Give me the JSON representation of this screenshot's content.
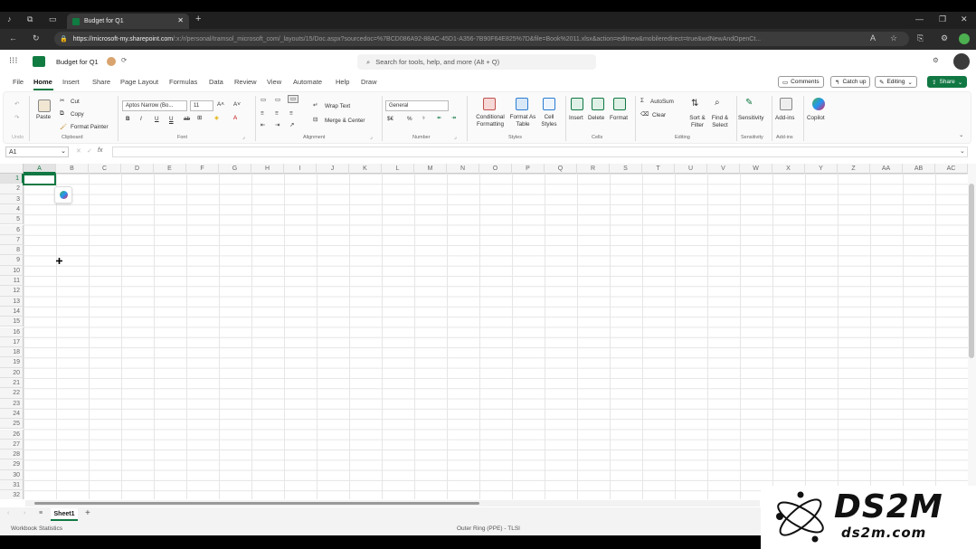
{
  "browser": {
    "tab_title": "Budget for Q1",
    "url_host": "https://microsoft-my.sharepoint.com",
    "url_rest": "/:x:/r/personal/tramsol_microsoft_com/_layouts/15/Doc.aspx?sourcedoc=%7BCD086A92-88AC-45D1-A356-7B90F64E825%7D&file=Book%2011.xlsx&action=editnew&mobileredirect=true&wdNewAndOpenCt..."
  },
  "app": {
    "doc_title": "Budget for Q1",
    "search_placeholder": "Search for tools, help, and more (Alt + Q)"
  },
  "ribbon_tabs": [
    "File",
    "Home",
    "Insert",
    "Share",
    "Page Layout",
    "Formulas",
    "Data",
    "Review",
    "View",
    "Automate",
    "Help",
    "Draw"
  ],
  "header_buttons": {
    "comments": "Comments",
    "catch_up": "Catch up",
    "editing": "Editing",
    "share": "Share"
  },
  "ribbon": {
    "clipboard": {
      "paste": "Paste",
      "cut": "Cut",
      "copy": "Copy",
      "format_painter": "Format Painter",
      "label": "Clipboard",
      "undo_label": "Undo"
    },
    "font": {
      "font_name": "Aptos Narrow (Bo...",
      "font_size": "11",
      "label": "Font"
    },
    "alignment": {
      "wrap_text": "Wrap Text",
      "merge_center": "Merge & Center",
      "label": "Alignment"
    },
    "number": {
      "format": "General",
      "label": "Number"
    },
    "styles": {
      "conditional": "Conditional Formatting",
      "format_as_table": "Format As Table",
      "cell_styles": "Cell Styles",
      "label": "Styles"
    },
    "cells": {
      "insert": "Insert",
      "delete": "Delete",
      "format": "Format",
      "label": "Cells"
    },
    "editing": {
      "autosum": "AutoSum",
      "clear": "Clear",
      "sort_filter": "Sort & Filter",
      "find_select": "Find & Select",
      "label": "Editing"
    },
    "sensitivity": {
      "button": "Sensitivity",
      "label": "Sensitivity"
    },
    "addins": {
      "button": "Add-ins",
      "label": "Add-ins"
    },
    "copilot": {
      "button": "Copilot"
    }
  },
  "formula_bar": {
    "name_box": "A1",
    "fx": "fx"
  },
  "columns": [
    "A",
    "B",
    "C",
    "D",
    "E",
    "F",
    "G",
    "H",
    "I",
    "J",
    "K",
    "L",
    "M",
    "N",
    "O",
    "P",
    "Q",
    "R",
    "S",
    "T",
    "U",
    "V",
    "W",
    "X",
    "Y",
    "Z",
    "AA",
    "AB",
    "AC"
  ],
  "rows": [
    "1",
    "2",
    "3",
    "4",
    "5",
    "6",
    "7",
    "8",
    "9",
    "10",
    "11",
    "12",
    "13",
    "14",
    "15",
    "16",
    "17",
    "18",
    "19",
    "20",
    "21",
    "22",
    "23",
    "24",
    "25",
    "26",
    "27",
    "28",
    "29",
    "30",
    "31",
    "32"
  ],
  "sheet_tab": "Sheet1",
  "status": {
    "left": "Workbook Statistics",
    "center": "Outer Ring (PPE) - TLSI"
  },
  "watermark": {
    "brand": "DS2M",
    "url": "ds2m.com"
  },
  "colors": {
    "accent": "#117843",
    "brand_excel": "#107c41"
  }
}
